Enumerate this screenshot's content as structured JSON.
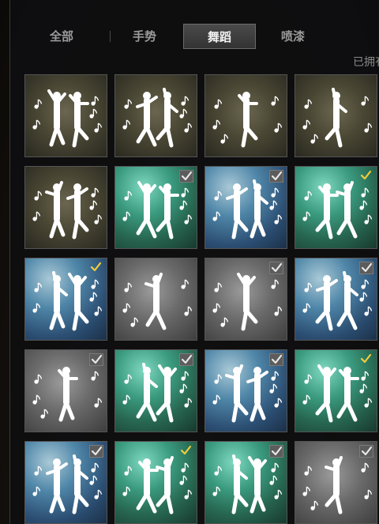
{
  "tabs": [
    {
      "label": "全部",
      "active": false
    },
    {
      "label": "手势",
      "active": false
    },
    {
      "label": "舞蹈",
      "active": true
    },
    {
      "label": "喷漆",
      "active": false
    }
  ],
  "owned_label": "已拥有",
  "cards": [
    {
      "bg": "olive",
      "check": "none",
      "icon": "duo-dance-icon"
    },
    {
      "bg": "olive",
      "check": "none",
      "icon": "duo-crouch-dance-icon"
    },
    {
      "bg": "olive",
      "check": "none",
      "icon": "solo-hip-dance-icon"
    },
    {
      "bg": "olive",
      "check": "none",
      "icon": "solo-disco-dance-icon"
    },
    {
      "bg": "olive",
      "check": "none",
      "icon": "duo-sing-dance-icon"
    },
    {
      "bg": "green",
      "check": "gray",
      "icon": "duo-point-dance-icon"
    },
    {
      "bg": "blue",
      "check": "gray",
      "icon": "duo-wave-dance-icon"
    },
    {
      "bg": "green",
      "check": "gold",
      "icon": "duo-kick-dance-icon"
    },
    {
      "bg": "blue",
      "check": "gold",
      "icon": "duo-sway-dance-icon"
    },
    {
      "bg": "gray",
      "check": "none",
      "icon": "solo-groove-dance-icon"
    },
    {
      "bg": "gray",
      "check": "gray",
      "icon": "solo-ballet-dance-icon"
    },
    {
      "bg": "blue",
      "check": "gray",
      "icon": "duo-arm-dance-icon"
    },
    {
      "bg": "gray",
      "check": "gray",
      "icon": "solo-hop-dance-icon"
    },
    {
      "bg": "green",
      "check": "gray",
      "icon": "duo-shuffle-dance-icon"
    },
    {
      "bg": "blue",
      "check": "gray",
      "icon": "duo-flex-dance-icon"
    },
    {
      "bg": "green",
      "check": "gold",
      "icon": "duo-stretch-dance-icon"
    },
    {
      "bg": "blue",
      "check": "gray",
      "icon": "duo-jump-dance-icon"
    },
    {
      "bg": "green",
      "check": "gold",
      "icon": "duo-cheer-dance-icon"
    },
    {
      "bg": "green",
      "check": "gray",
      "icon": "duo-reach-dance-icon"
    },
    {
      "bg": "gray",
      "check": "gray",
      "icon": "solo-spin-dance-icon"
    }
  ]
}
